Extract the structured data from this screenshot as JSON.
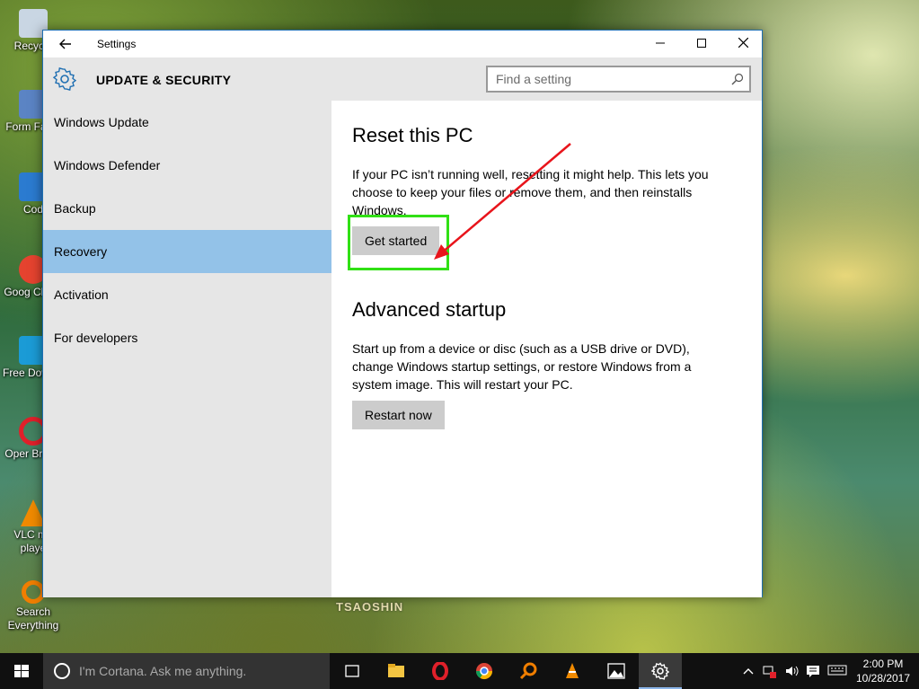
{
  "desktop": {
    "icons": [
      {
        "label": "Recycle",
        "icon": "recycle-bin-icon",
        "color": "#c9d6e3"
      },
      {
        "label": "Form Facto",
        "icon": "format-factory-icon",
        "color": "#5b84c4"
      },
      {
        "label": "Cod",
        "icon": "vscode-icon",
        "color": "#2b7bd0"
      },
      {
        "label": "Goog Chron",
        "icon": "chrome-icon",
        "color": "#e5432f"
      },
      {
        "label": "Free Downlo",
        "icon": "download-icon",
        "color": "#1b9bd6"
      },
      {
        "label": "Oper Brows",
        "icon": "opera-icon",
        "color": "#e0202a"
      },
      {
        "label": "VLC me playe",
        "icon": "vlc-icon",
        "color": "#f08a00"
      },
      {
        "label": "Search Everything",
        "icon": "search-everything-icon",
        "color": "#f07e00"
      }
    ],
    "watermark": "TSAOSHIN"
  },
  "window": {
    "title": "Settings",
    "header": "UPDATE & SECURITY",
    "search_placeholder": "Find a setting"
  },
  "sidebar": {
    "items": [
      {
        "label": "Windows Update",
        "active": false
      },
      {
        "label": "Windows Defender",
        "active": false
      },
      {
        "label": "Backup",
        "active": false
      },
      {
        "label": "Recovery",
        "active": true
      },
      {
        "label": "Activation",
        "active": false
      },
      {
        "label": "For developers",
        "active": false
      }
    ]
  },
  "content": {
    "reset": {
      "title": "Reset this PC",
      "description": "If your PC isn’t running well, resetting it might help. This lets you choose to keep your files or remove them, and then reinstalls Windows.",
      "button": "Get started"
    },
    "advanced": {
      "title": "Advanced startup",
      "description": "Start up from a device or disc (such as a USB drive or DVD), change Windows startup settings, or restore Windows from a system image. This will restart your PC.",
      "button": "Restart now"
    }
  },
  "annotation": {
    "highlight_color": "#31e015",
    "arrow_color": "#e8141b"
  },
  "taskbar": {
    "cortana_placeholder": "I'm Cortana. Ask me anything.",
    "apps": [
      "task-view-icon",
      "file-explorer-icon",
      "opera-icon",
      "chrome-icon",
      "search-everything-icon",
      "vlc-icon",
      "photos-icon",
      "settings-icon"
    ],
    "time": "2:00 PM",
    "date": "10/28/2017"
  }
}
